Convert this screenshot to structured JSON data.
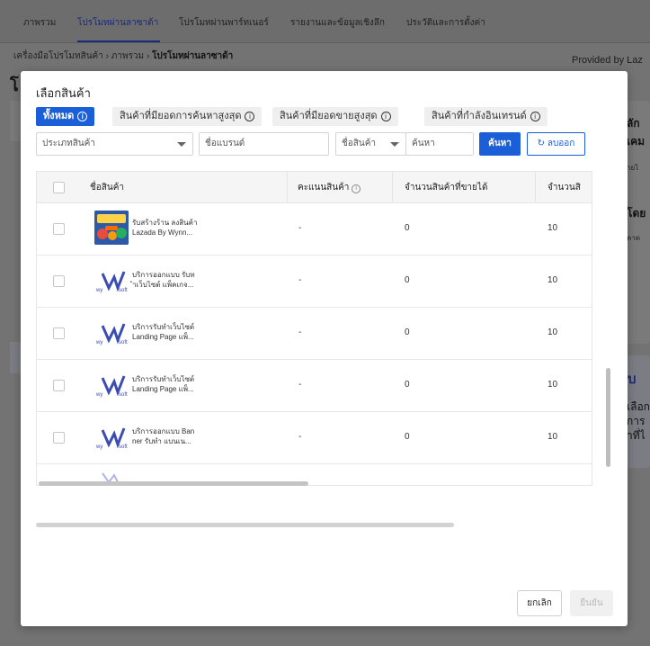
{
  "topnav": {
    "items": [
      "ภาพรวม",
      "โปรโมทผ่านลาซาด้า",
      "โปรโมทผ่านพาร์ทเนอร์",
      "รายงานและข้อมูลเชิงลึก",
      "ประวัติและการตั้งค่า"
    ],
    "active_index": 1
  },
  "breadcrumb": {
    "root": "เครื่องมือโปรโมทสินค้า",
    "mid": "ภาพรวม",
    "current": "โปรโมทผ่านลาซาด้า",
    "separator": "›"
  },
  "provided_by": "Provided by Laz",
  "background": {
    "title": "โ",
    "right_texts": [
      "ลัก",
      "เคม",
      "ายไ",
      "โดย",
      "คาด",
      "บ",
      "เลือก",
      "การ",
      "าที่ไ"
    ]
  },
  "modal": {
    "title": "เลือกสินค้า",
    "tabs": [
      {
        "label": "ทั้งหมด",
        "info": "i"
      },
      {
        "label": "สินค้าที่มียอดการค้นหาสูงสุด",
        "info": "i"
      },
      {
        "label": "สินค้าที่มียอดขายสูงสุด",
        "info": "i"
      },
      {
        "label": "สินค้าที่กำลังอินเทรนด์",
        "info": "i"
      }
    ],
    "filters": {
      "category_placeholder": "ประเภทสินค้า",
      "brand_placeholder": "ชื่อแบรนด์",
      "search_field_select": "ชื่อสินค้า",
      "search_placeholder": "ค้นหา",
      "search_button": "ค้นหา",
      "clear_button": "ลบออก",
      "clear_icon": "↻"
    },
    "table": {
      "columns": [
        "ชื่อสินค้า",
        "คะแนนสินค้า",
        "จำนวนสินค้าที่ขายได้",
        "จำนวนสิ"
      ],
      "score_info": "i",
      "rows": [
        {
          "name_line1": "รับสร้างร้าน ลงสินค้า",
          "name_line2": "Lazada By Wynn...",
          "thumb": "lazada",
          "score": "-",
          "sold": "0",
          "qty": "10"
        },
        {
          "name_line1": "บริการออกแบบ รับท",
          "name_line2": "ำเว็บไซต์ แพ็คเกจ...",
          "thumb": "wynnsoft",
          "score": "-",
          "sold": "0",
          "qty": "10"
        },
        {
          "name_line1": "บริการรับทำเว็บไซต์",
          "name_line2": "Landing Page แพ็...",
          "thumb": "wynnsoft",
          "score": "-",
          "sold": "0",
          "qty": "10"
        },
        {
          "name_line1": "บริการรับทำเว็บไซต์",
          "name_line2": "Landing Page แพ็...",
          "thumb": "wynnsoft",
          "score": "-",
          "sold": "0",
          "qty": "10"
        },
        {
          "name_line1": "บริการออกแบบ Ban",
          "name_line2": "ner รับทำ แบนเน...",
          "thumb": "wynnsoft",
          "score": "-",
          "sold": "0",
          "qty": "10"
        }
      ]
    },
    "footer": {
      "cancel": "ยกเลิก",
      "confirm": "ยืนยัน"
    }
  },
  "colors": {
    "primary": "#1a5fd8",
    "overlay": "#737373"
  }
}
